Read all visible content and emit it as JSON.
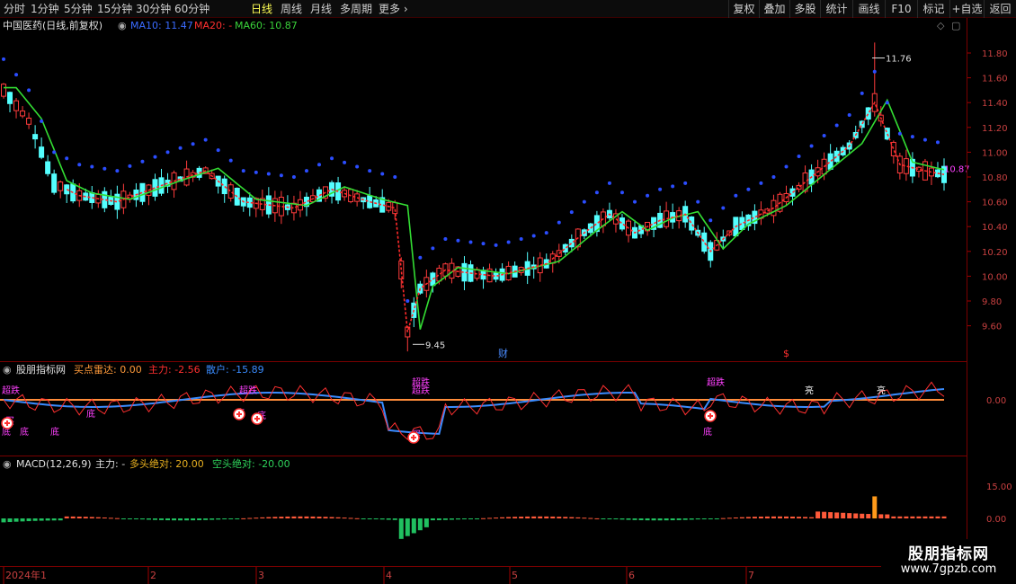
{
  "toolbar": {
    "periods": [
      "分时",
      "1分钟",
      "5分钟",
      "15分钟",
      "30分钟",
      "60分钟",
      "日线",
      "周线",
      "月线",
      "多周期",
      "更多"
    ],
    "active_period": "日线",
    "right_buttons": [
      "复权",
      "叠加",
      "多股",
      "统计",
      "画线",
      "F10",
      "标记",
      "+自选",
      "返回"
    ]
  },
  "main_panel": {
    "stock_name": "中国医药(日线,前复权)",
    "ma10_label": "MA10: 11.47",
    "ma20_label": "MA20: -",
    "ma60_label": "MA60: 10.87",
    "ma10_color": "#3a6bff",
    "ma20_color": "#ff3030",
    "ma60_color": "#3ad13a",
    "price_ticks": [
      "11.80",
      "11.60",
      "11.40",
      "11.20",
      "11.00",
      "10.80",
      "10.60",
      "10.40",
      "10.20",
      "10.00",
      "9.80",
      "9.60"
    ],
    "high_annotation": "11.76",
    "low_annotation": "9.45",
    "last_price_label": "10.87",
    "markers": [
      "财",
      "$"
    ]
  },
  "indicator_panel": {
    "title": "股朋指标网",
    "buy_radar": "买点雷达: 0.00",
    "main_force": "主力: -2.56",
    "retail": "散户: -15.89",
    "zero_tick": "0.00",
    "labels": [
      "超跌",
      "超跌",
      "超跌",
      "底",
      "底",
      "底",
      "底",
      "买",
      "底",
      "底",
      "超跌",
      "买",
      "超跌",
      "底",
      "亮",
      "亮"
    ]
  },
  "macd_panel": {
    "title": "MACD(12,26,9)",
    "main_force": "主力: -",
    "bull": "多头绝对: 20.00",
    "bear": "空头绝对: -20.00",
    "ticks": [
      "15.00",
      "0.00"
    ]
  },
  "date_axis": {
    "labels": [
      "2024年1",
      "2",
      "3",
      "4",
      "5",
      "6",
      "7"
    ]
  },
  "watermark": {
    "title": "股朋指标网",
    "url": "www.7gpzb.com"
  }
}
